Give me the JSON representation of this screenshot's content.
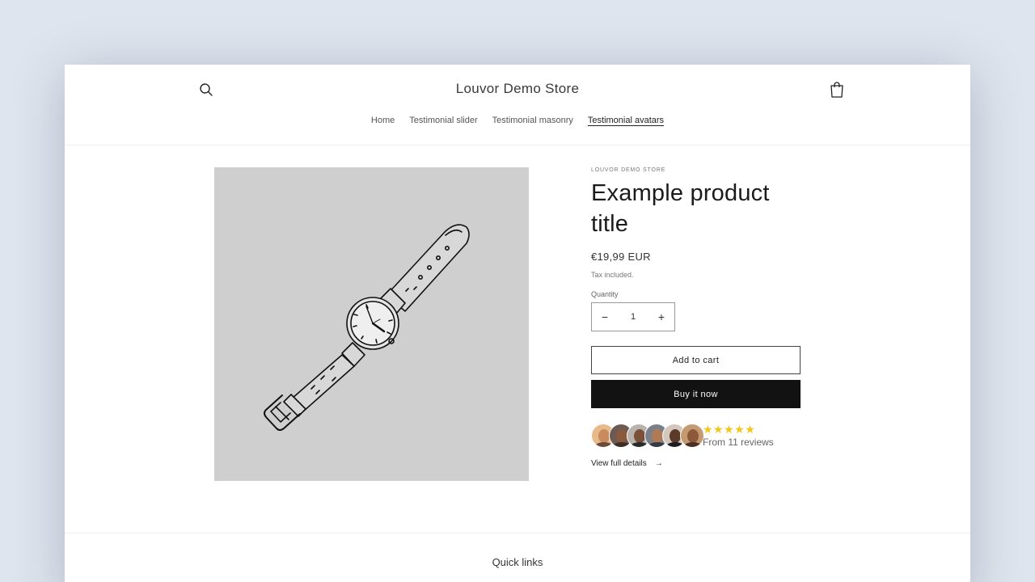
{
  "header": {
    "store_name": "Louvor Demo Store",
    "search_icon": "search-icon",
    "cart_icon": "shopping-bag-icon"
  },
  "nav": {
    "items": [
      {
        "label": "Home"
      },
      {
        "label": "Testimonial slider"
      },
      {
        "label": "Testimonial masonry"
      },
      {
        "label": "Testimonial avatars",
        "active": true
      }
    ]
  },
  "product": {
    "vendor": "LOUVOR DEMO STORE",
    "title": "Example product title",
    "price": "€19,99 EUR",
    "tax_note": "Tax included.",
    "quantity_label": "Quantity",
    "quantity": "1",
    "add_to_cart": "Add to cart",
    "buy_now": "Buy it now",
    "image": "wristwatch line-art illustration"
  },
  "reviews": {
    "stars": "★★★★★",
    "rating": 5,
    "summary": "From 11 reviews",
    "avatar_count": 6
  },
  "links": {
    "view_details": "View full details",
    "arrow": "→"
  },
  "footer": {
    "heading": "Quick links"
  },
  "colors": {
    "page_bg": "#dfe5ee",
    "image_bg": "#cfcfcf",
    "buy_button": "#121212",
    "star": "#f5c518"
  }
}
